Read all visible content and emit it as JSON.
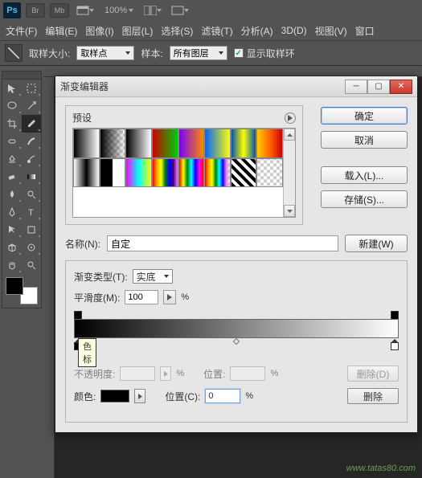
{
  "header": {
    "ps": "Ps",
    "btns": [
      "Br",
      "Mb"
    ],
    "zoom": "100%"
  },
  "menubar": [
    "文件(F)",
    "编辑(E)",
    "图像(I)",
    "图层(L)",
    "选择(S)",
    "滤镜(T)",
    "分析(A)",
    "3D(D)",
    "视图(V)",
    "窗口"
  ],
  "options": {
    "size_label": "取样大小:",
    "size_value": "取样点",
    "sample_label": "样本:",
    "sample_value": "所有图层",
    "ring_label": "显示取样环"
  },
  "dialog": {
    "title": "渐变编辑器",
    "presets_label": "预设",
    "buttons": {
      "ok": "确定",
      "cancel": "取消",
      "load": "载入(L)...",
      "save": "存储(S)...",
      "new": "新建(W)"
    },
    "name_label": "名称(N):",
    "name_value": "自定",
    "type_label": "渐变类型(T):",
    "type_value": "实底",
    "smooth_label": "平滑度(M):",
    "smooth_value": "100",
    "pct": "%",
    "tooltip": "色标",
    "stops": {
      "opacity_label": "不透明度:",
      "pos_label": "位置:",
      "color_label": "颜色:",
      "posc_label": "位置(C):",
      "posc_value": "0",
      "delete_d": "删除(D)",
      "delete": "删除"
    }
  },
  "watermark": "www.tatas80.com"
}
